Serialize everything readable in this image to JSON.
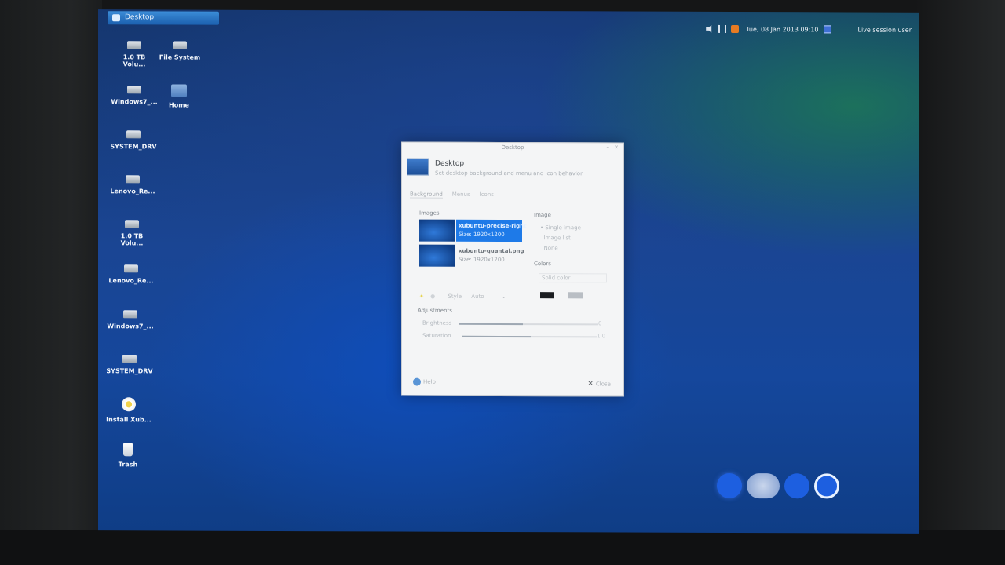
{
  "panel": {
    "task_label": "Desktop",
    "clock": "Tue, 08 Jan 2013 09:10",
    "user": "Live session user"
  },
  "desktop_icons": [
    {
      "label": "1.0 TB Volu..."
    },
    {
      "label": "File System"
    },
    {
      "label": "Windows7_..."
    },
    {
      "label": "Home"
    },
    {
      "label": "SYSTEM_DRV"
    },
    {
      "label": "Lenovo_Re..."
    },
    {
      "label": "1.0 TB Volu..."
    },
    {
      "label": "Lenovo_Re..."
    },
    {
      "label": "Windows7_..."
    },
    {
      "label": "SYSTEM_DRV"
    },
    {
      "label": "Install Xub..."
    },
    {
      "label": "Trash"
    }
  ],
  "dialog": {
    "window_title": "Desktop",
    "heading": "Desktop",
    "subtitle": "Set desktop background and menu and icon behavior",
    "tabs": [
      "Background",
      "Menus",
      "Icons"
    ],
    "images_label": "Images",
    "images": [
      {
        "name": "xubuntu-precise-right",
        "size": "Size: 1920x1200"
      },
      {
        "name": "xubuntu-quantal.png",
        "size": "Size: 1920x1200"
      }
    ],
    "image_label": "Image",
    "image_options": [
      "Single image",
      "Image list",
      "None"
    ],
    "colors_label": "Colors",
    "colors_mode": "Solid color",
    "color1": "#1b1d21",
    "color2": "#b9bec4",
    "style_label": "Style",
    "style_value": "Auto",
    "adjustments_label": "Adjustments",
    "brightness_label": "Brightness",
    "brightness_value": "0",
    "saturation_label": "Saturation",
    "saturation_value": "1.0",
    "help_label": "Help",
    "close_label": "Close"
  }
}
